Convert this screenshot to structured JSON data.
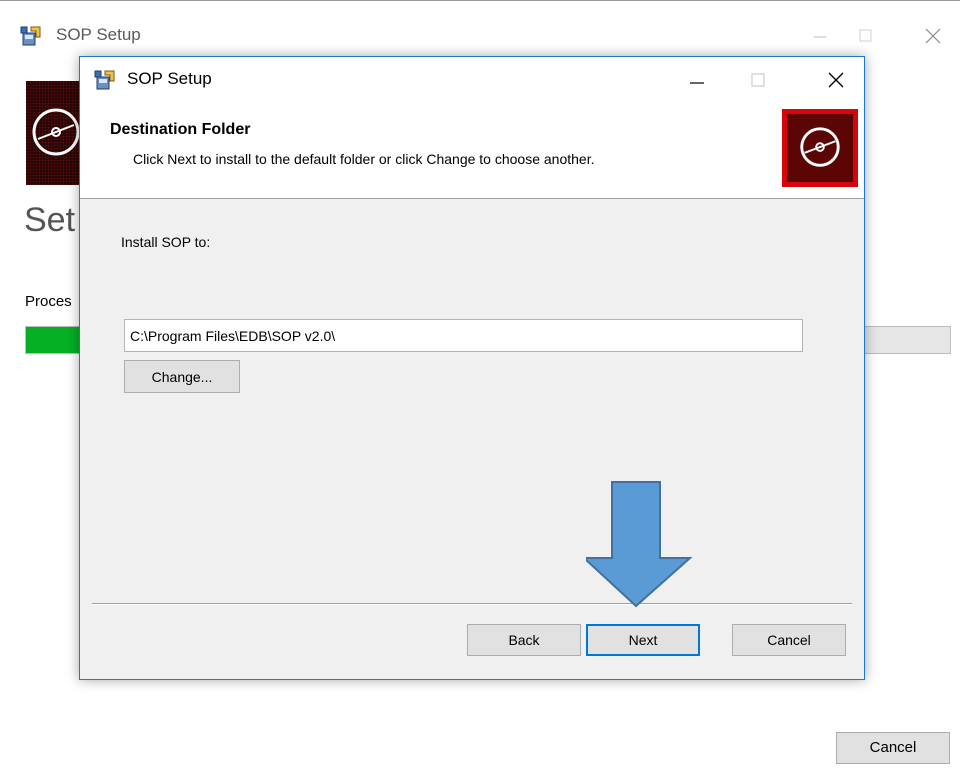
{
  "background_window": {
    "title": "SOP Setup",
    "heading": "Set",
    "status_text": "Proces",
    "progress_fraction": 0.06,
    "cancel_label": "Cancel"
  },
  "dialog": {
    "title": "SOP Setup",
    "header_title": "Destination Folder",
    "header_subtitle": "Click Next to install to the default folder or click Change to choose another.",
    "install_label": "Install SOP to:",
    "install_path": "C:\\Program Files\\EDB\\SOP v2.0\\",
    "change_label": "Change...",
    "back_label": "Back",
    "next_label": "Next",
    "cancel_label": "Cancel"
  },
  "icons": {
    "app": "installer-icon",
    "banner": "disc-icon",
    "annotation": "arrow-down-icon"
  },
  "colors": {
    "accent": "#0078d7",
    "progress": "#06b025",
    "logo_red": "#d4060b",
    "arrow_fill": "#5b9bd5"
  }
}
